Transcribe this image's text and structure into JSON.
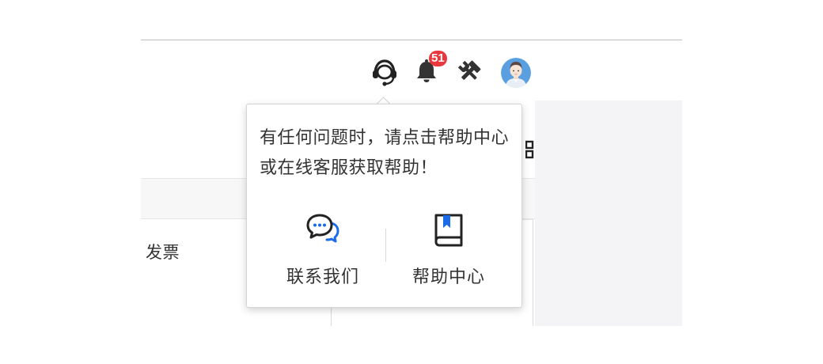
{
  "header": {
    "notification_badge": "51",
    "icons": [
      "headset-icon",
      "bell-icon",
      "tools-icon",
      "avatar"
    ]
  },
  "content": {
    "row_text": "发票"
  },
  "popover": {
    "message": "有任何问题时，请点击帮助中心或在线客服获取帮助！",
    "actions": [
      {
        "label": "联系我们",
        "icon": "chat-bubble-icon"
      },
      {
        "label": "帮助中心",
        "icon": "book-icon"
      }
    ]
  },
  "colors": {
    "badge": "#e8383d",
    "accent": "#1a6be8",
    "avatar_bg": "#5aa0e0"
  }
}
